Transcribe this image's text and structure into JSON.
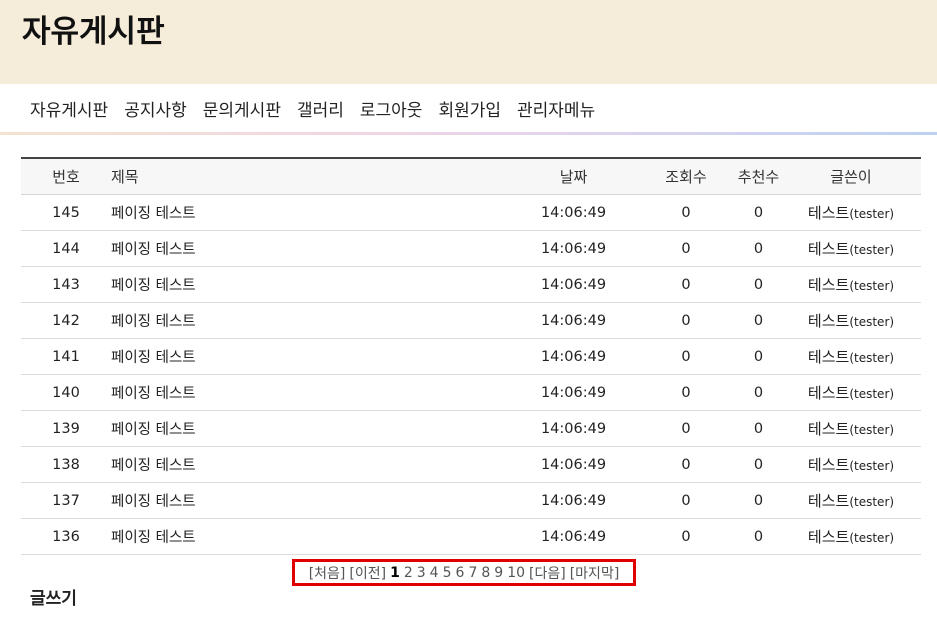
{
  "header": {
    "title": "자유게시판"
  },
  "nav": {
    "items": [
      "자유게시판",
      "공지사항",
      "문의게시판",
      "갤러리",
      "로그아웃",
      "회원가입",
      "관리자메뉴"
    ]
  },
  "table": {
    "headers": {
      "num": "번호",
      "title": "제목",
      "date": "날짜",
      "views": "조회수",
      "recommend": "추천수",
      "writer": "글쓴이"
    },
    "rows": [
      {
        "num": "145",
        "title": "페이징 테스트",
        "date": "14:06:49",
        "views": "0",
        "recommend": "0",
        "writer_name": "테스트",
        "writer_id": "(tester)"
      },
      {
        "num": "144",
        "title": "페이징 테스트",
        "date": "14:06:49",
        "views": "0",
        "recommend": "0",
        "writer_name": "테스트",
        "writer_id": "(tester)"
      },
      {
        "num": "143",
        "title": "페이징 테스트",
        "date": "14:06:49",
        "views": "0",
        "recommend": "0",
        "writer_name": "테스트",
        "writer_id": "(tester)"
      },
      {
        "num": "142",
        "title": "페이징 테스트",
        "date": "14:06:49",
        "views": "0",
        "recommend": "0",
        "writer_name": "테스트",
        "writer_id": "(tester)"
      },
      {
        "num": "141",
        "title": "페이징 테스트",
        "date": "14:06:49",
        "views": "0",
        "recommend": "0",
        "writer_name": "테스트",
        "writer_id": "(tester)"
      },
      {
        "num": "140",
        "title": "페이징 테스트",
        "date": "14:06:49",
        "views": "0",
        "recommend": "0",
        "writer_name": "테스트",
        "writer_id": "(tester)"
      },
      {
        "num": "139",
        "title": "페이징 테스트",
        "date": "14:06:49",
        "views": "0",
        "recommend": "0",
        "writer_name": "테스트",
        "writer_id": "(tester)"
      },
      {
        "num": "138",
        "title": "페이징 테스트",
        "date": "14:06:49",
        "views": "0",
        "recommend": "0",
        "writer_name": "테스트",
        "writer_id": "(tester)"
      },
      {
        "num": "137",
        "title": "페이징 테스트",
        "date": "14:06:49",
        "views": "0",
        "recommend": "0",
        "writer_name": "테스트",
        "writer_id": "(tester)"
      },
      {
        "num": "136",
        "title": "페이징 테스트",
        "date": "14:06:49",
        "views": "0",
        "recommend": "0",
        "writer_name": "테스트",
        "writer_id": "(tester)"
      }
    ]
  },
  "pager": {
    "first": "[처음]",
    "prev": "[이전]",
    "pages": [
      "1",
      "2",
      "3",
      "4",
      "5",
      "6",
      "7",
      "8",
      "9",
      "10"
    ],
    "current": "1",
    "next": "[다음]",
    "last": "[마지막]",
    "highlight_color": "#e00000"
  },
  "write_button": "글쓰기",
  "colors": {
    "header_bg": "#f6ecda",
    "table_header_bg": "#f7f7f7"
  }
}
